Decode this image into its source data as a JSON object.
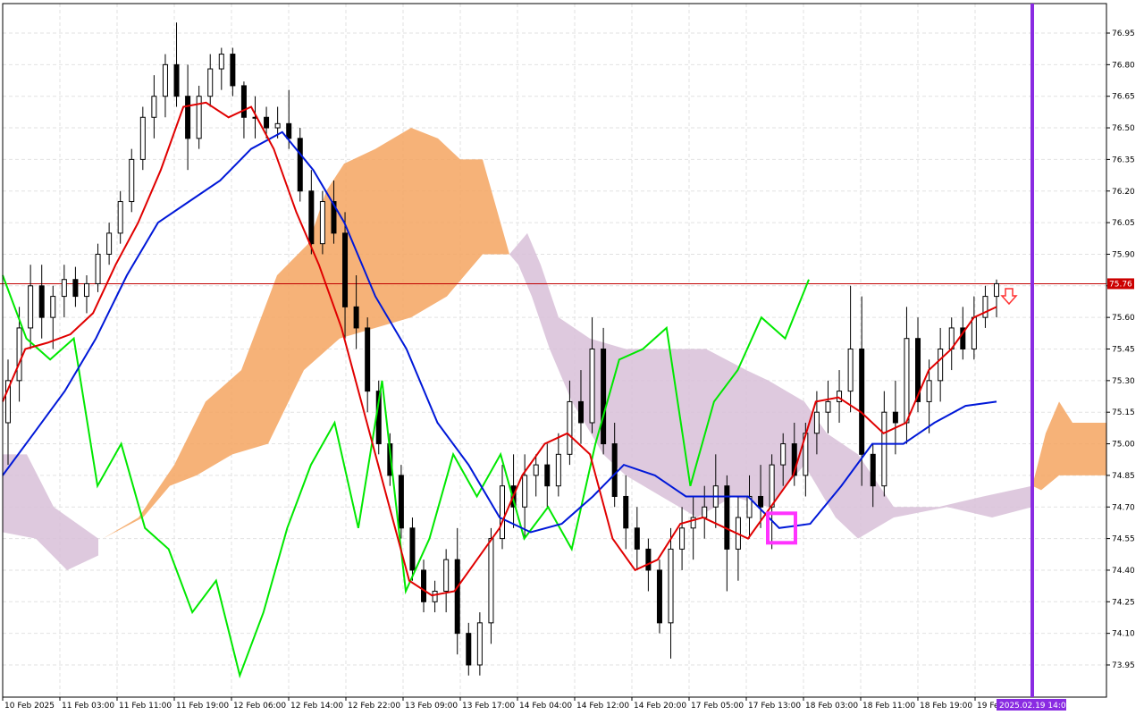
{
  "chart_data": {
    "type": "candlestick",
    "y_ticks": [
      "76.95",
      "76.80",
      "76.65",
      "76.50",
      "76.35",
      "76.20",
      "76.05",
      "75.90",
      "75.75",
      "75.60",
      "75.45",
      "75.30",
      "75.15",
      "75.00",
      "74.85",
      "74.70",
      "74.55",
      "74.40",
      "74.25",
      "74.10",
      "73.95"
    ],
    "ylim": [
      73.85,
      77.05
    ],
    "x_ticks": [
      "10 Feb 2025",
      "11 Feb 03:00",
      "11 Feb 11:00",
      "11 Feb 19:00",
      "12 Feb 06:00",
      "12 Feb 14:00",
      "12 Feb 22:00",
      "13 Feb 09:00",
      "13 Feb 17:00",
      "14 Feb 04:00",
      "14 Feb 12:00",
      "14 Feb 20:00",
      "17 Feb 05:00",
      "17 Feb 13:00",
      "18 Feb 03:00",
      "18 Feb 11:00",
      "18 Feb 19:00",
      "19 Feb"
    ],
    "current_price": "75.76",
    "vertical_line_label": "2025.02.19 14:00",
    "grid": true,
    "colors": {
      "tenkan": "#e00000",
      "kijun": "#0018d8",
      "chikou": "#00e800",
      "kumo_bullish": "#f4a460",
      "kumo_bearish": "#d8bfd8",
      "price_line": "#c00000",
      "vertical_line": "#8a2be2",
      "marker_box": "#ff33ff",
      "arrow": "#ff3030"
    },
    "candles": [
      {
        "o": 75.1,
        "h": 75.4,
        "l": 74.9,
        "c": 75.3
      },
      {
        "o": 75.3,
        "h": 75.65,
        "l": 75.2,
        "c": 75.55
      },
      {
        "o": 75.55,
        "h": 75.85,
        "l": 75.45,
        "c": 75.75
      },
      {
        "o": 75.75,
        "h": 75.85,
        "l": 75.5,
        "c": 75.6
      },
      {
        "o": 75.6,
        "h": 75.75,
        "l": 75.45,
        "c": 75.7
      },
      {
        "o": 75.7,
        "h": 75.85,
        "l": 75.6,
        "c": 75.78
      },
      {
        "o": 75.78,
        "h": 75.84,
        "l": 75.65,
        "c": 75.7
      },
      {
        "o": 75.7,
        "h": 75.8,
        "l": 75.62,
        "c": 75.76
      },
      {
        "o": 75.76,
        "h": 75.95,
        "l": 75.72,
        "c": 75.9
      },
      {
        "o": 75.9,
        "h": 76.05,
        "l": 75.85,
        "c": 76.0
      },
      {
        "o": 76.0,
        "h": 76.2,
        "l": 75.95,
        "c": 76.15
      },
      {
        "o": 76.15,
        "h": 76.4,
        "l": 76.1,
        "c": 76.35
      },
      {
        "o": 76.35,
        "h": 76.6,
        "l": 76.3,
        "c": 76.55
      },
      {
        "o": 76.55,
        "h": 76.75,
        "l": 76.45,
        "c": 76.65
      },
      {
        "o": 76.65,
        "h": 76.85,
        "l": 76.55,
        "c": 76.8
      },
      {
        "o": 76.8,
        "h": 77.0,
        "l": 76.6,
        "c": 76.65
      },
      {
        "o": 76.65,
        "h": 76.8,
        "l": 76.3,
        "c": 76.45
      },
      {
        "o": 76.45,
        "h": 76.7,
        "l": 76.4,
        "c": 76.65
      },
      {
        "o": 76.65,
        "h": 76.85,
        "l": 76.6,
        "c": 76.78
      },
      {
        "o": 76.78,
        "h": 76.88,
        "l": 76.68,
        "c": 76.85
      },
      {
        "o": 76.85,
        "h": 76.88,
        "l": 76.65,
        "c": 76.7
      },
      {
        "o": 76.7,
        "h": 76.72,
        "l": 76.45,
        "c": 76.55
      },
      {
        "o": 76.55,
        "h": 76.65,
        "l": 76.45,
        "c": 76.55
      },
      {
        "o": 76.55,
        "h": 76.6,
        "l": 76.45,
        "c": 76.5
      },
      {
        "o": 76.5,
        "h": 76.6,
        "l": 76.45,
        "c": 76.52
      },
      {
        "o": 76.52,
        "h": 76.68,
        "l": 76.4,
        "c": 76.45
      },
      {
        "o": 76.45,
        "h": 76.5,
        "l": 76.15,
        "c": 76.2
      },
      {
        "o": 76.2,
        "h": 76.3,
        "l": 75.9,
        "c": 75.95
      },
      {
        "o": 75.95,
        "h": 76.2,
        "l": 75.9,
        "c": 76.15
      },
      {
        "o": 76.15,
        "h": 76.25,
        "l": 75.95,
        "c": 76.0
      },
      {
        "o": 76.0,
        "h": 76.1,
        "l": 75.5,
        "c": 75.65
      },
      {
        "o": 75.65,
        "h": 75.8,
        "l": 75.45,
        "c": 75.55
      },
      {
        "o": 75.55,
        "h": 75.6,
        "l": 75.15,
        "c": 75.25
      },
      {
        "o": 75.25,
        "h": 75.3,
        "l": 74.95,
        "c": 75.0
      },
      {
        "o": 75.0,
        "h": 75.05,
        "l": 74.8,
        "c": 74.85
      },
      {
        "o": 74.85,
        "h": 74.9,
        "l": 74.55,
        "c": 74.6
      },
      {
        "o": 74.6,
        "h": 74.65,
        "l": 74.35,
        "c": 74.4
      },
      {
        "o": 74.4,
        "h": 74.45,
        "l": 74.2,
        "c": 74.25
      },
      {
        "o": 74.25,
        "h": 74.35,
        "l": 74.2,
        "c": 74.3
      },
      {
        "o": 74.3,
        "h": 74.5,
        "l": 74.2,
        "c": 74.45
      },
      {
        "o": 74.45,
        "h": 74.6,
        "l": 74.0,
        "c": 74.1
      },
      {
        "o": 74.1,
        "h": 74.15,
        "l": 73.9,
        "c": 73.95
      },
      {
        "o": 73.95,
        "h": 74.2,
        "l": 73.9,
        "c": 74.15
      },
      {
        "o": 74.15,
        "h": 74.6,
        "l": 74.05,
        "c": 74.55
      },
      {
        "o": 74.55,
        "h": 74.9,
        "l": 74.5,
        "c": 74.8
      },
      {
        "o": 74.8,
        "h": 74.95,
        "l": 74.6,
        "c": 74.7
      },
      {
        "o": 74.7,
        "h": 74.95,
        "l": 74.55,
        "c": 74.85
      },
      {
        "o": 74.85,
        "h": 74.95,
        "l": 74.75,
        "c": 74.9
      },
      {
        "o": 74.9,
        "h": 75.0,
        "l": 74.7,
        "c": 74.8
      },
      {
        "o": 74.8,
        "h": 75.05,
        "l": 74.75,
        "c": 74.95
      },
      {
        "o": 74.95,
        "h": 75.3,
        "l": 74.9,
        "c": 75.2
      },
      {
        "o": 75.2,
        "h": 75.35,
        "l": 75.0,
        "c": 75.1
      },
      {
        "o": 75.1,
        "h": 75.6,
        "l": 75.05,
        "c": 75.45
      },
      {
        "o": 75.45,
        "h": 75.55,
        "l": 74.95,
        "c": 75.0
      },
      {
        "o": 75.0,
        "h": 75.1,
        "l": 74.7,
        "c": 74.75
      },
      {
        "o": 74.75,
        "h": 74.85,
        "l": 74.5,
        "c": 74.6
      },
      {
        "o": 74.6,
        "h": 74.7,
        "l": 74.4,
        "c": 74.5
      },
      {
        "o": 74.5,
        "h": 74.55,
        "l": 74.3,
        "c": 74.4
      },
      {
        "o": 74.4,
        "h": 74.45,
        "l": 74.1,
        "c": 74.15
      },
      {
        "o": 74.15,
        "h": 74.6,
        "l": 73.98,
        "c": 74.5
      },
      {
        "o": 74.5,
        "h": 74.7,
        "l": 74.4,
        "c": 74.6
      },
      {
        "o": 74.6,
        "h": 74.75,
        "l": 74.45,
        "c": 74.65
      },
      {
        "o": 74.65,
        "h": 74.8,
        "l": 74.55,
        "c": 74.7
      },
      {
        "o": 74.7,
        "h": 74.95,
        "l": 74.6,
        "c": 74.8
      },
      {
        "o": 74.8,
        "h": 74.85,
        "l": 74.3,
        "c": 74.5
      },
      {
        "o": 74.5,
        "h": 74.75,
        "l": 74.35,
        "c": 74.65
      },
      {
        "o": 74.65,
        "h": 74.85,
        "l": 74.55,
        "c": 74.75
      },
      {
        "o": 74.75,
        "h": 74.9,
        "l": 74.6,
        "c": 74.7
      },
      {
        "o": 74.7,
        "h": 74.95,
        "l": 74.5,
        "c": 74.9
      },
      {
        "o": 74.9,
        "h": 75.05,
        "l": 74.8,
        "c": 75.0
      },
      {
        "o": 75.0,
        "h": 75.1,
        "l": 74.8,
        "c": 74.85
      },
      {
        "o": 74.85,
        "h": 75.1,
        "l": 74.75,
        "c": 75.05
      },
      {
        "o": 75.05,
        "h": 75.25,
        "l": 74.95,
        "c": 75.15
      },
      {
        "o": 75.15,
        "h": 75.3,
        "l": 75.05,
        "c": 75.2
      },
      {
        "o": 75.2,
        "h": 75.35,
        "l": 75.1,
        "c": 75.25
      },
      {
        "o": 75.25,
        "h": 75.75,
        "l": 75.15,
        "c": 75.45
      },
      {
        "o": 75.45,
        "h": 75.7,
        "l": 74.8,
        "c": 74.95
      },
      {
        "o": 74.95,
        "h": 75.0,
        "l": 74.7,
        "c": 74.8
      },
      {
        "o": 74.8,
        "h": 75.25,
        "l": 74.75,
        "c": 75.15
      },
      {
        "o": 75.15,
        "h": 75.3,
        "l": 74.95,
        "c": 75.1
      },
      {
        "o": 75.1,
        "h": 75.65,
        "l": 75.0,
        "c": 75.5
      },
      {
        "o": 75.5,
        "h": 75.6,
        "l": 75.15,
        "c": 75.2
      },
      {
        "o": 75.2,
        "h": 75.4,
        "l": 75.05,
        "c": 75.3
      },
      {
        "o": 75.3,
        "h": 75.55,
        "l": 75.2,
        "c": 75.45
      },
      {
        "o": 75.45,
        "h": 75.6,
        "l": 75.35,
        "c": 75.55
      },
      {
        "o": 75.55,
        "h": 75.65,
        "l": 75.4,
        "c": 75.45
      },
      {
        "o": 75.45,
        "h": 75.7,
        "l": 75.4,
        "c": 75.6
      },
      {
        "o": 75.6,
        "h": 75.75,
        "l": 75.55,
        "c": 75.7
      },
      {
        "o": 75.7,
        "h": 75.78,
        "l": 75.6,
        "c": 75.76
      }
    ],
    "tenkan": [
      75.2,
      75.45,
      75.48,
      75.52,
      75.62,
      75.85,
      76.05,
      76.3,
      76.6,
      76.62,
      76.55,
      76.6,
      76.4,
      76.1,
      75.85,
      75.55,
      75.15,
      74.75,
      74.35,
      74.28,
      74.3,
      74.45,
      74.6,
      74.85,
      75.0,
      75.05,
      74.95,
      74.55,
      74.4,
      74.45,
      74.62,
      74.65,
      74.6,
      74.55,
      74.7,
      74.85,
      75.2,
      75.22,
      75.15,
      75.05,
      75.1,
      75.35,
      75.45,
      75.6,
      75.65
    ],
    "kijun": [
      74.85,
      75.05,
      75.25,
      75.5,
      75.8,
      76.05,
      76.15,
      76.25,
      76.4,
      76.48,
      76.3,
      76.05,
      75.7,
      75.45,
      75.1,
      74.9,
      74.65,
      74.58,
      74.62,
      74.75,
      74.9,
      74.85,
      74.75,
      74.75,
      74.75,
      74.6,
      74.62,
      74.8,
      75.0,
      75.0,
      75.1,
      75.18,
      75.2
    ],
    "chikou": [
      75.8,
      75.5,
      75.4,
      75.5,
      74.8,
      75.0,
      74.6,
      74.5,
      74.2,
      74.35,
      73.9,
      74.2,
      74.6,
      74.9,
      75.1,
      74.6,
      75.3,
      74.3,
      74.55,
      74.95,
      74.75,
      74.95,
      74.55,
      74.7,
      74.5,
      75.0,
      75.4,
      75.45,
      75.55,
      74.8,
      75.2,
      75.35,
      75.6,
      75.5,
      75.78
    ]
  }
}
